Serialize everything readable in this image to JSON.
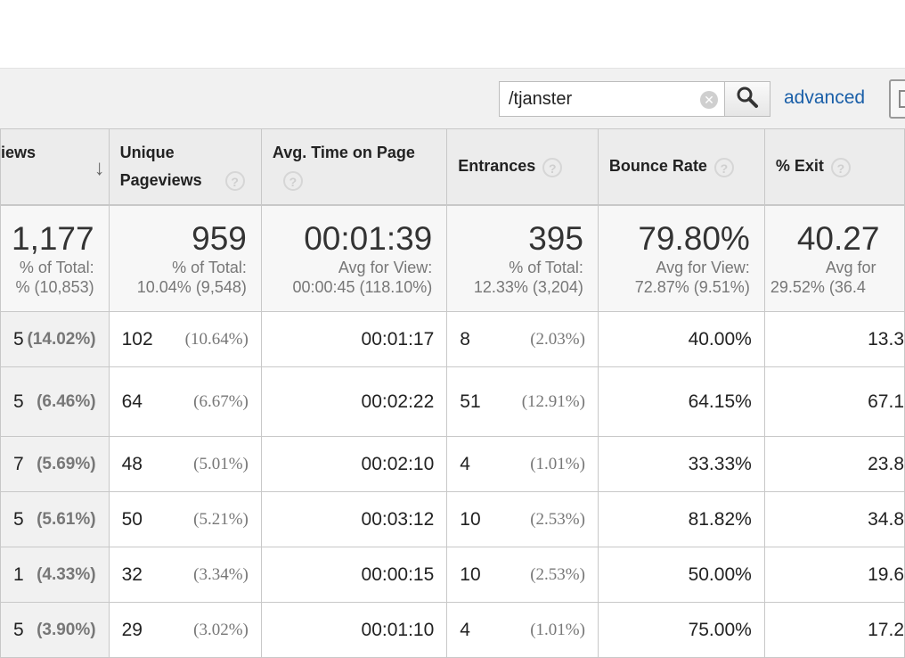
{
  "toolbar": {
    "search_value": "/tjanster",
    "advanced_label": "advanced"
  },
  "columns": [
    {
      "label": "iews",
      "sorted": true
    },
    {
      "label": "Unique Pageviews"
    },
    {
      "label": "Avg. Time on Page"
    },
    {
      "label": "Entrances"
    },
    {
      "label": "Bounce Rate"
    },
    {
      "label": "% Exit"
    }
  ],
  "summary": [
    {
      "value": "1,177",
      "line1": "% of Total:",
      "line2": "% (10,853)"
    },
    {
      "value": "959",
      "line1": "% of Total:",
      "line2": "10.04% (9,548)"
    },
    {
      "value": "00:01:39",
      "line1": "Avg for View:",
      "line2": "00:00:45 (118.10%)"
    },
    {
      "value": "395",
      "line1": "% of Total:",
      "line2": "12.33% (3,204)"
    },
    {
      "value": "79.80%",
      "line1": "Avg for View:",
      "line2": "72.87% (9.51%)"
    },
    {
      "value": "40.27",
      "line1": "Avg for",
      "line2": "29.52% (36.4"
    }
  ],
  "rows": [
    {
      "pv": "5",
      "pv_pct": "(14.02%)",
      "upv": "102",
      "upv_pct": "(10.64%)",
      "avg_time": "00:01:17",
      "ent": "8",
      "ent_pct": "(2.03%)",
      "bounce": "40.00%",
      "exit": "13.3"
    },
    {
      "pv": "5",
      "pv_pct": "(6.46%)",
      "upv": "64",
      "upv_pct": "(6.67%)",
      "avg_time": "00:02:22",
      "ent": "51",
      "ent_pct": "(12.91%)",
      "bounce": "64.15%",
      "exit": "67.1"
    },
    {
      "pv": "7",
      "pv_pct": "(5.69%)",
      "upv": "48",
      "upv_pct": "(5.01%)",
      "avg_time": "00:02:10",
      "ent": "4",
      "ent_pct": "(1.01%)",
      "bounce": "33.33%",
      "exit": "23.8"
    },
    {
      "pv": "5",
      "pv_pct": "(5.61%)",
      "upv": "50",
      "upv_pct": "(5.21%)",
      "avg_time": "00:03:12",
      "ent": "10",
      "ent_pct": "(2.53%)",
      "bounce": "81.82%",
      "exit": "34.8"
    },
    {
      "pv": "1",
      "pv_pct": "(4.33%)",
      "upv": "32",
      "upv_pct": "(3.34%)",
      "avg_time": "00:00:15",
      "ent": "10",
      "ent_pct": "(2.53%)",
      "bounce": "50.00%",
      "exit": "19.6"
    },
    {
      "pv": "5",
      "pv_pct": "(3.90%)",
      "upv": "29",
      "upv_pct": "(3.02%)",
      "avg_time": "00:01:10",
      "ent": "4",
      "ent_pct": "(1.01%)",
      "bounce": "75.00%",
      "exit": "17.2"
    }
  ]
}
